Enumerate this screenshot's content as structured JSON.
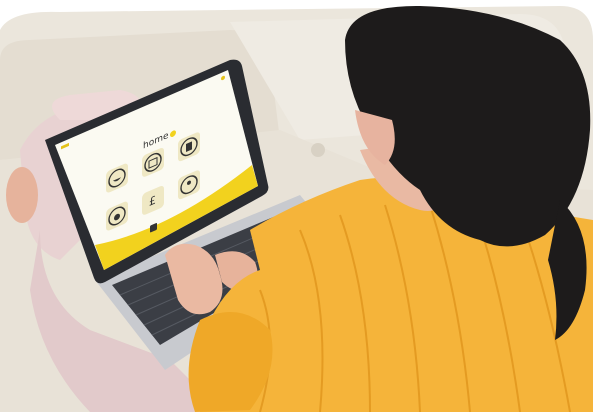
{
  "scene": {
    "subject": "person-using-laptop-on-sofa",
    "colors": {
      "sofa": "#e9e4da",
      "sofa_shadow": "#d6d0c4",
      "blouse": "#f5b43a",
      "blouse_shadow": "#e39a22",
      "hair": "#1c1a1a",
      "skin": "#e9b9a3",
      "pants": "#e7cfd0",
      "laptop_body": "#c9cbd0",
      "laptop_dark": "#3a3d44",
      "screen_bg": "#fbfaf2",
      "screen_accent": "#f2d21e",
      "icon_tile": "#efe8c4"
    }
  },
  "laptop_screen": {
    "app_title": "home",
    "top_right_icon": "close-icon",
    "top_left_icon": "menu-icon",
    "tiles": [
      {
        "icon": "rice-bowl-icon"
      },
      {
        "icon": "calendar-icon"
      },
      {
        "icon": "book-icon"
      },
      {
        "icon": "money-bag-icon"
      },
      {
        "icon": "pound-sign-icon"
      },
      {
        "icon": "person-icon"
      }
    ],
    "footer_icon": "home-icon"
  }
}
